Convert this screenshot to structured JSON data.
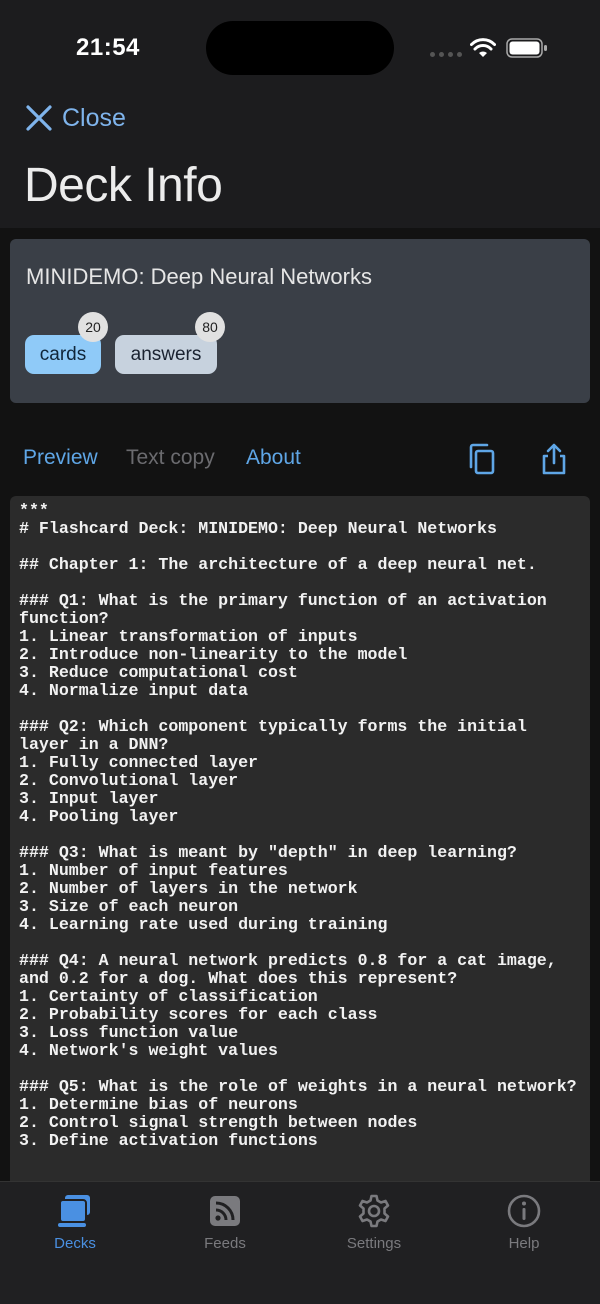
{
  "status_bar": {
    "time": "21:54"
  },
  "nav": {
    "close_label": "Close",
    "title": "Deck Info"
  },
  "deck": {
    "name": "MINIDEMO: Deep Neural Networks",
    "chips": [
      {
        "label": "cards",
        "count": "20"
      },
      {
        "label": "answers",
        "count": "80"
      }
    ]
  },
  "tabs": {
    "preview": "Preview",
    "text_copy": "Text copy",
    "about": "About"
  },
  "preview_text": "***\n# Flashcard Deck: MINIDEMO: Deep Neural Networks\n\n## Chapter 1: The architecture of a deep neural net.\n\n### Q1: What is the primary function of an activation function?\n1. Linear transformation of inputs\n2. Introduce non-linearity to the model\n3. Reduce computational cost\n4. Normalize input data\n\n### Q2: Which component typically forms the initial layer in a DNN?\n1. Fully connected layer\n2. Convolutional layer\n3. Input layer\n4. Pooling layer\n\n### Q3: What is meant by \"depth\" in deep learning?\n1. Number of input features\n2. Number of layers in the network\n3. Size of each neuron\n4. Learning rate used during training\n\n### Q4: A neural network predicts 0.8 for a cat image, and 0.2 for a dog. What does this represent?\n1. Certainty of classification\n2. Probability scores for each class\n3. Loss function value\n4. Network's weight values\n\n### Q5: What is the role of weights in a neural network?\n1. Determine bias of neurons\n2. Control signal strength between nodes\n3. Define activation functions",
  "tab_bar": {
    "items": [
      {
        "label": "Decks",
        "icon": "decks-icon",
        "active": true
      },
      {
        "label": "Feeds",
        "icon": "rss-icon",
        "active": false
      },
      {
        "label": "Settings",
        "icon": "gear-icon",
        "active": false
      },
      {
        "label": "Help",
        "icon": "info-icon",
        "active": false
      }
    ]
  },
  "colors": {
    "accent": "#4a90e2",
    "link": "#5fa6e6",
    "chip_cards": "#8fcaf8",
    "chip_answers": "#c7d2de"
  }
}
